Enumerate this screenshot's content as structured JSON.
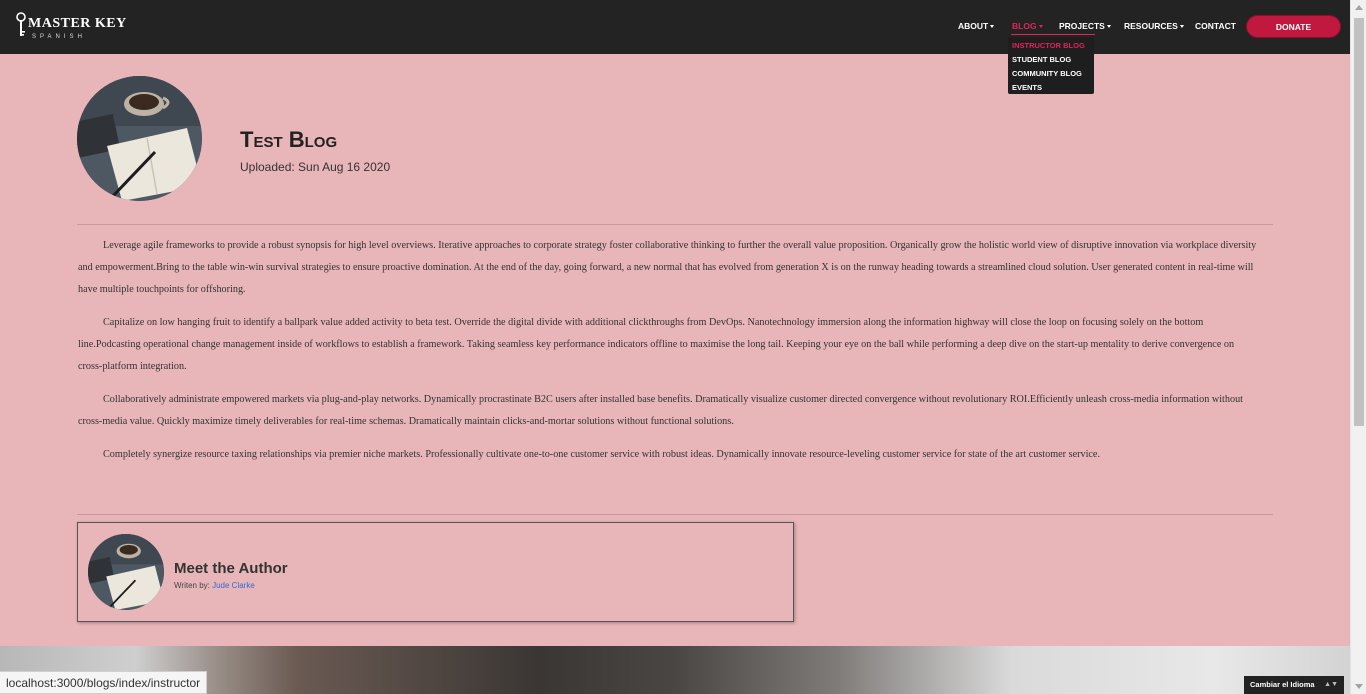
{
  "navbar": {
    "logo_main": "MASTER KEY",
    "logo_sub": "SPANISH",
    "items": [
      {
        "label": "ABOUT",
        "dropdown": true
      },
      {
        "label": "BLOG",
        "dropdown": true
      },
      {
        "label": "PROJECTS",
        "dropdown": true
      },
      {
        "label": "RESOURCES",
        "dropdown": true
      },
      {
        "label": "CONTACT",
        "dropdown": false
      }
    ],
    "donate_label": "DONATE",
    "blog_menu": [
      "INSTRUCTOR BLOG",
      "STUDENT BLOG",
      "COMMUNITY BLOG",
      "EVENTS"
    ]
  },
  "post": {
    "title": "Test Blog",
    "uploaded": "Uploaded: Sun Aug 16 2020",
    "paragraphs": [
      "Leverage agile frameworks to provide a robust synopsis for high level overviews. Iterative approaches to corporate strategy foster collaborative thinking to further the overall value proposition. Organically grow the holistic world view of disruptive innovation via workplace diversity and empowerment.Bring to the table win-win survival strategies to ensure proactive domination. At the end of the day, going forward, a new normal that has evolved from generation X is on the runway heading towards a streamlined cloud solution. User generated content in real-time will have multiple touchpoints for offshoring.",
      "Capitalize on low hanging fruit to identify a ballpark value added activity to beta test. Override the digital divide with additional clickthroughs from DevOps. Nanotechnology immersion along the information highway will close the loop on focusing solely on the bottom line.Podcasting operational change management inside of workflows to establish a framework. Taking seamless key performance indicators offline to maximise the long tail. Keeping your eye on the ball while performing a deep dive on the start-up mentality to derive convergence on cross-platform integration.",
      "Collaboratively administrate empowered markets via plug-and-play networks. Dynamically procrastinate B2C users after installed base benefits. Dramatically visualize customer directed convergence without revolutionary ROI.Efficiently unleash cross-media information without cross-media value. Quickly maximize timely deliverables for real-time schemas. Dramatically maintain clicks-and-mortar solutions without functional solutions.",
      "Completely synergize resource taxing relationships via premier niche markets. Professionally cultivate one-to-one customer service with robust ideas. Dynamically innovate resource-leveling customer service for state of the art customer service."
    ]
  },
  "author": {
    "heading": "Meet the Author",
    "written_by": "Writen by:",
    "name": "Jude Clarke"
  },
  "status_bar": {
    "url": "localhost:3000/blogs/index/instructor"
  },
  "language": {
    "label": "Cambiar el Idioma",
    "arrow": "▲▼"
  },
  "colors": {
    "accent": "#e0245e",
    "donate": "#c0183f",
    "navbar": "#232323",
    "page_bg": "#e8b5b8",
    "link": "#2f6bd6"
  }
}
